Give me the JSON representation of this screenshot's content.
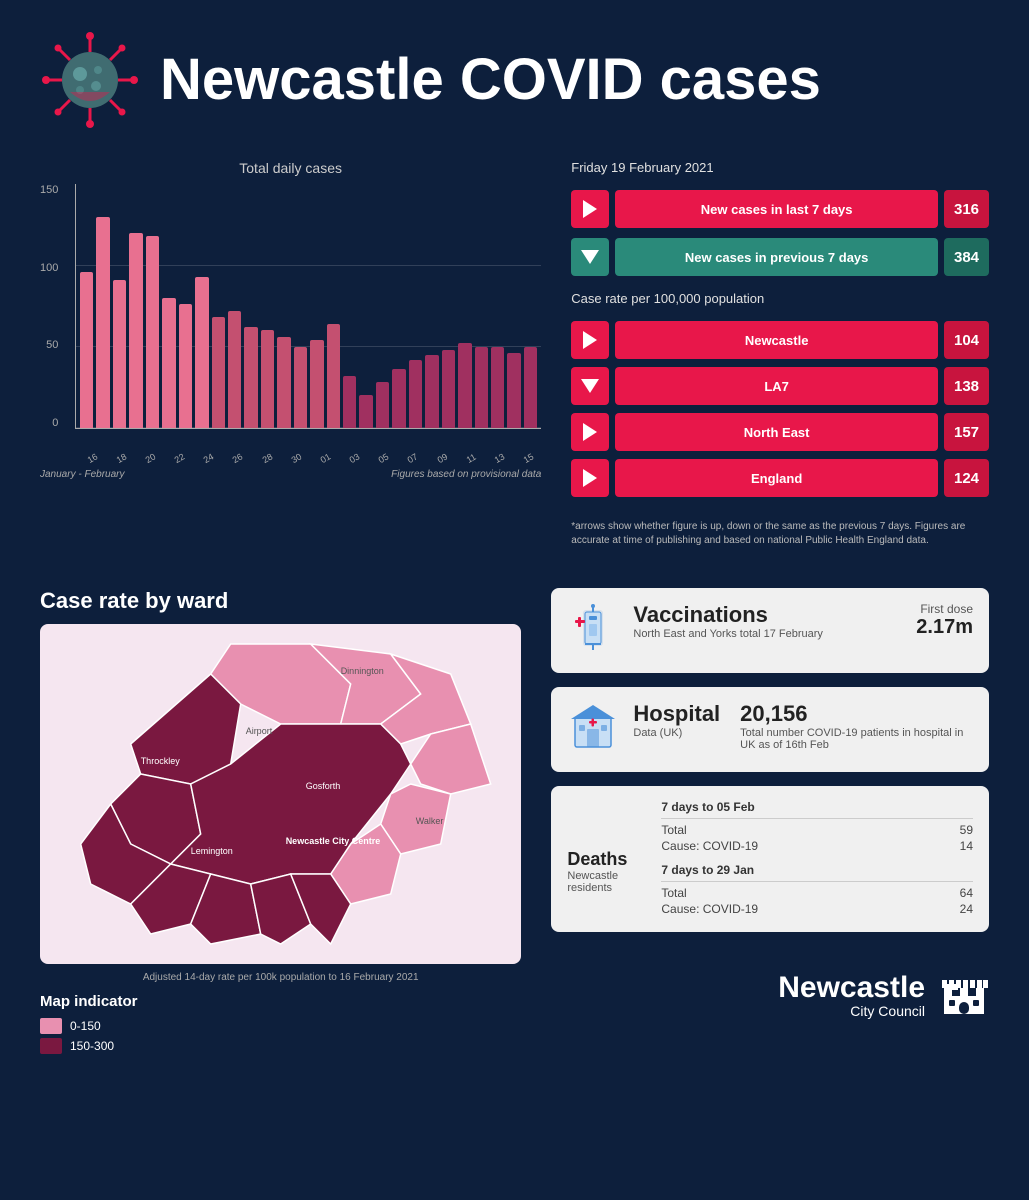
{
  "header": {
    "title": "Newcastle COVID cases"
  },
  "chart": {
    "title": "Total daily cases",
    "y_labels": [
      "150",
      "100",
      "50",
      "0"
    ],
    "x_labels": [
      "16",
      "18",
      "20",
      "22",
      "24",
      "26",
      "28",
      "30",
      "01",
      "03",
      "05",
      "07",
      "09",
      "11",
      "13",
      "15"
    ],
    "x_axis_note": "January - February",
    "footnote": "Figures based on provisional data",
    "bars": [
      {
        "value": 96,
        "color": "#e87090"
      },
      {
        "value": 130,
        "color": "#e87090"
      },
      {
        "value": 91,
        "color": "#e87090"
      },
      {
        "value": 120,
        "color": "#e87090"
      },
      {
        "value": 118,
        "color": "#e87090"
      },
      {
        "value": 80,
        "color": "#e87090"
      },
      {
        "value": 76,
        "color": "#e87090"
      },
      {
        "value": 93,
        "color": "#e87090"
      },
      {
        "value": 68,
        "color": "#c45070"
      },
      {
        "value": 72,
        "color": "#c45070"
      },
      {
        "value": 62,
        "color": "#c45070"
      },
      {
        "value": 60,
        "color": "#c45070"
      },
      {
        "value": 56,
        "color": "#c45070"
      },
      {
        "value": 50,
        "color": "#c45070"
      },
      {
        "value": 54,
        "color": "#c45070"
      },
      {
        "value": 64,
        "color": "#c45070"
      },
      {
        "value": 32,
        "color": "#a03060"
      },
      {
        "value": 20,
        "color": "#a03060"
      },
      {
        "value": 28,
        "color": "#a03060"
      },
      {
        "value": 36,
        "color": "#a03060"
      },
      {
        "value": 42,
        "color": "#a03060"
      },
      {
        "value": 45,
        "color": "#a03060"
      },
      {
        "value": 48,
        "color": "#a03060"
      },
      {
        "value": 52,
        "color": "#a03060"
      },
      {
        "value": 50,
        "color": "#a03060"
      },
      {
        "value": 50,
        "color": "#a03060"
      },
      {
        "value": 46,
        "color": "#a03060"
      },
      {
        "value": 50,
        "color": "#a03060"
      }
    ]
  },
  "stats": {
    "date_label": "Friday 19 February 2021",
    "new_cases_label": "New cases in last 7 days",
    "new_cases_value": "316",
    "prev_cases_label": "New cases in previous 7 days",
    "prev_cases_value": "384",
    "case_rate_section": "Case rate per 100,000 population",
    "items": [
      {
        "label": "Newcastle",
        "value": "104",
        "arrow": "right"
      },
      {
        "label": "LA7",
        "value": "138",
        "arrow": "down"
      },
      {
        "label": "North East",
        "value": "157",
        "arrow": "right"
      },
      {
        "label": "England",
        "value": "124",
        "arrow": "right"
      }
    ],
    "footnote": "*arrows show whether figure is up, down or the same as the previous 7 days. Figures are accurate at time of publishing and based on national Public Health England data."
  },
  "map": {
    "title": "Case rate by ward",
    "footnote": "Adjusted 14-day rate per 100k population to 16 February 2021",
    "legend_title": "Map indicator",
    "legend_items": [
      {
        "range": "0-150",
        "color": "#e890b0"
      },
      {
        "range": "150-300",
        "color": "#7a1840"
      }
    ]
  },
  "cards": {
    "vaccinations": {
      "title": "Vaccinations",
      "subtitle": "North East and Yorks total 17 February",
      "dose_label": "First dose",
      "dose_value": "2.17m"
    },
    "hospital": {
      "title": "Hospital",
      "subtitle": "Data (UK)",
      "value": "20,156",
      "desc": "Total number COVID-19 patients in hospital in UK as of 16th Feb"
    },
    "deaths": {
      "title": "Deaths",
      "subtitle": "Newcastle residents",
      "period1_label": "7 days to 05 Feb",
      "period1_total_label": "Total",
      "period1_total": "59",
      "period1_covid_label": "Cause: COVID-19",
      "period1_covid": "14",
      "period2_label": "7 days to 29 Jan",
      "period2_total_label": "Total",
      "period2_total": "64",
      "period2_covid_label": "Cause: COVID-19",
      "period2_covid": "24"
    }
  },
  "logo": {
    "name": "Newcastle",
    "sub": "City Council"
  }
}
